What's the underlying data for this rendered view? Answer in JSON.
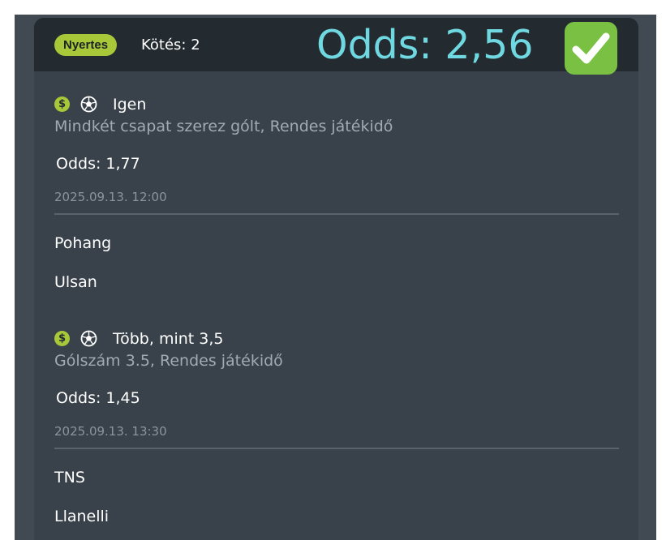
{
  "header": {
    "status_badge": "Nyertes",
    "bet_count": "Kötés: 2",
    "total_odds": "Odds: 2,56",
    "result_icon": "check-mark-icon",
    "colors": {
      "badge": "#a8c83a",
      "total_odds": "#6fd8e0",
      "check": "#7ac143"
    }
  },
  "selections": [
    {
      "icons": [
        "dollar-icon",
        "soccer-ball-icon"
      ],
      "pick": "Igen",
      "market": "Mindkét csapat szerez gólt, Rendes játékidő",
      "odds": "Odds: 1,77",
      "datetime": "2025.09.13.  12:00",
      "home_team": "Pohang",
      "away_team": "Ulsan"
    },
    {
      "icons": [
        "dollar-icon",
        "soccer-ball-icon"
      ],
      "pick": "Több, mint 3,5",
      "market": "Gólszám 3.5, Rendes játékidő",
      "odds": "Odds: 1,45",
      "datetime": "2025.09.13.  13:30",
      "home_team": "TNS",
      "away_team": "Llanelli"
    }
  ]
}
